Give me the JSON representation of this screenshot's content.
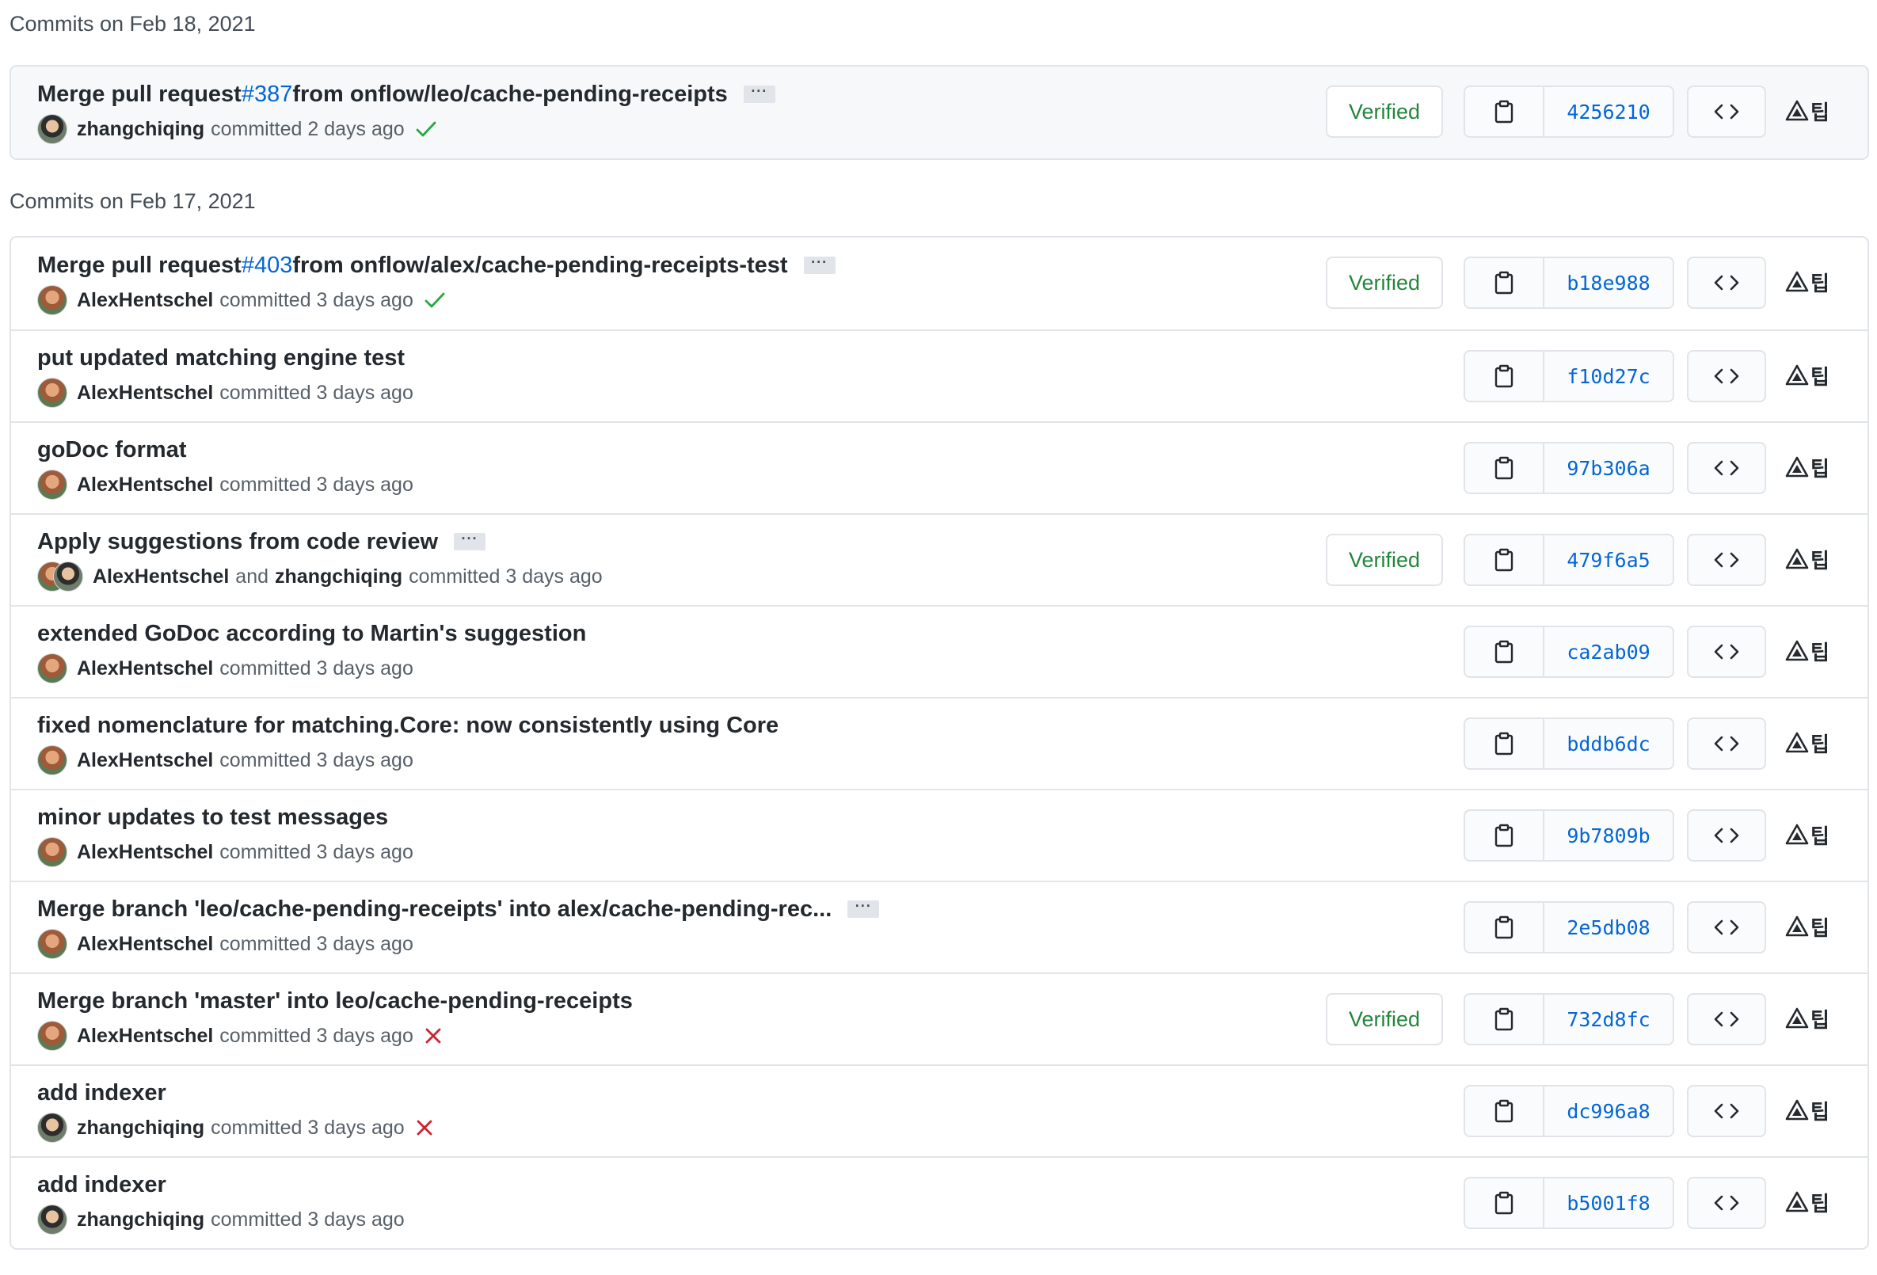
{
  "groups": [
    {
      "title": "Commits on Feb 18, 2021",
      "commits": [
        {
          "prefix": "Merge pull request ",
          "link": "#387",
          "rest": " from onflow/leo/cache-pending-receipts",
          "ellipsis": "···",
          "authors": [
            "zhangchiqing"
          ],
          "avatars": [
            "zhang"
          ],
          "when": "committed 2 days ago",
          "status": "check",
          "verified": "Verified",
          "sha": "4256210"
        }
      ]
    },
    {
      "title": "Commits on Feb 17, 2021",
      "commits": [
        {
          "prefix": "Merge pull request ",
          "link": "#403",
          "rest": " from onflow/alex/cache-pending-receipts-test",
          "ellipsis": "···",
          "authors": [
            "AlexHentschel"
          ],
          "avatars": [
            "alex"
          ],
          "when": "committed 3 days ago",
          "status": "check",
          "verified": "Verified",
          "sha": "b18e988"
        },
        {
          "prefix": "put updated matching engine test",
          "link": "",
          "rest": "",
          "ellipsis": "",
          "authors": [
            "AlexHentschel"
          ],
          "avatars": [
            "alex"
          ],
          "when": "committed 3 days ago",
          "status": "",
          "verified": "",
          "sha": "f10d27c"
        },
        {
          "prefix": "goDoc format",
          "link": "",
          "rest": "",
          "ellipsis": "",
          "authors": [
            "AlexHentschel"
          ],
          "avatars": [
            "alex"
          ],
          "when": "committed 3 days ago",
          "status": "",
          "verified": "",
          "sha": "97b306a"
        },
        {
          "prefix": "Apply suggestions from code review",
          "link": "",
          "rest": "",
          "ellipsis": "···",
          "authors": [
            "AlexHentschel",
            "zhangchiqing"
          ],
          "avatars": [
            "alex",
            "zhang"
          ],
          "and": "and",
          "when": "committed 3 days ago",
          "status": "",
          "verified": "Verified",
          "sha": "479f6a5"
        },
        {
          "prefix": "extended GoDoc according to Martin's suggestion",
          "link": "",
          "rest": "",
          "ellipsis": "",
          "authors": [
            "AlexHentschel"
          ],
          "avatars": [
            "alex"
          ],
          "when": "committed 3 days ago",
          "status": "",
          "verified": "",
          "sha": "ca2ab09"
        },
        {
          "prefix": "fixed nomenclature for matching.Core: now consistently using Core",
          "link": "",
          "rest": "",
          "ellipsis": "",
          "authors": [
            "AlexHentschel"
          ],
          "avatars": [
            "alex"
          ],
          "when": "committed 3 days ago",
          "status": "",
          "verified": "",
          "sha": "bddb6dc"
        },
        {
          "prefix": "minor updates to test messages",
          "link": "",
          "rest": "",
          "ellipsis": "",
          "authors": [
            "AlexHentschel"
          ],
          "avatars": [
            "alex"
          ],
          "when": "committed 3 days ago",
          "status": "",
          "verified": "",
          "sha": "9b7809b"
        },
        {
          "prefix": "Merge branch 'leo/cache-pending-receipts' into alex/cache-pending-rec...",
          "link": "",
          "rest": "",
          "ellipsis": "···",
          "authors": [
            "AlexHentschel"
          ],
          "avatars": [
            "alex"
          ],
          "when": "committed 3 days ago",
          "status": "",
          "verified": "",
          "sha": "2e5db08"
        },
        {
          "prefix": "Merge branch 'master' into leo/cache-pending-receipts",
          "link": "",
          "rest": "",
          "ellipsis": "",
          "authors": [
            "AlexHentschel"
          ],
          "avatars": [
            "alex"
          ],
          "when": "committed 3 days ago",
          "status": "x",
          "verified": "Verified",
          "sha": "732d8fc"
        },
        {
          "prefix": "add indexer",
          "link": "",
          "rest": "",
          "ellipsis": "",
          "authors": [
            "zhangchiqing"
          ],
          "avatars": [
            "zhang"
          ],
          "when": "committed 3 days ago",
          "status": "x",
          "verified": "",
          "sha": "dc996a8"
        },
        {
          "prefix": "add indexer",
          "link": "",
          "rest": "",
          "ellipsis": "",
          "authors": [
            "zhangchiqing"
          ],
          "avatars": [
            "zhang"
          ],
          "when": "committed 3 days ago",
          "status": "",
          "verified": "",
          "sha": "b5001f8"
        }
      ]
    }
  ],
  "icons": {
    "copy": "clipboard-icon",
    "browse": "code-icon",
    "extension": "warning-extension-icon",
    "extension_glyph": "팁",
    "check": "check-icon",
    "x": "x-icon"
  },
  "colors": {
    "link": "#0366d6",
    "verified": "#22863a",
    "success": "#28a745",
    "failure": "#cb2431"
  }
}
